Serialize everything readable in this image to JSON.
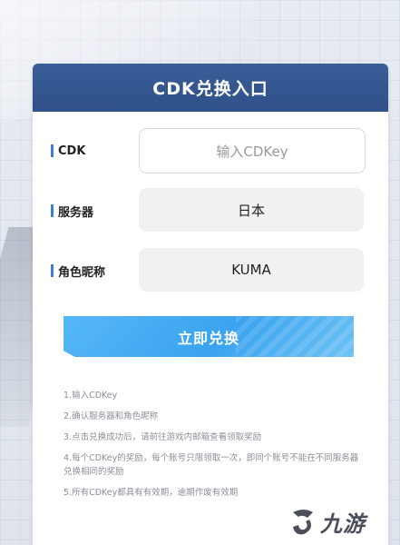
{
  "header": {
    "title": "CDK兑换入口"
  },
  "form": {
    "cdk": {
      "label": "CDK",
      "placeholder": "输入CDKey",
      "value": ""
    },
    "server": {
      "label": "服务器",
      "value": "日本"
    },
    "nickname": {
      "label": "角色昵称",
      "value": "KUMA"
    }
  },
  "submit_label": "立即兑换",
  "notes": [
    "1.输入CDKey",
    "2.确认服务器和角色昵称",
    "3.点击兑换成功后，请前往游戏内邮箱查看领取奖励",
    "4.每个CDKey的奖励，每个账号只限领取一次，即同个账号不能在不同服务器兑换相同的奖励",
    "5.所有CDKey都具有有效期，逾期作废有效期"
  ],
  "watermark": {
    "text": "九游"
  },
  "colors": {
    "header": "#2f5088",
    "accent": "#3f7fd8",
    "button": "#3aa3ef"
  }
}
